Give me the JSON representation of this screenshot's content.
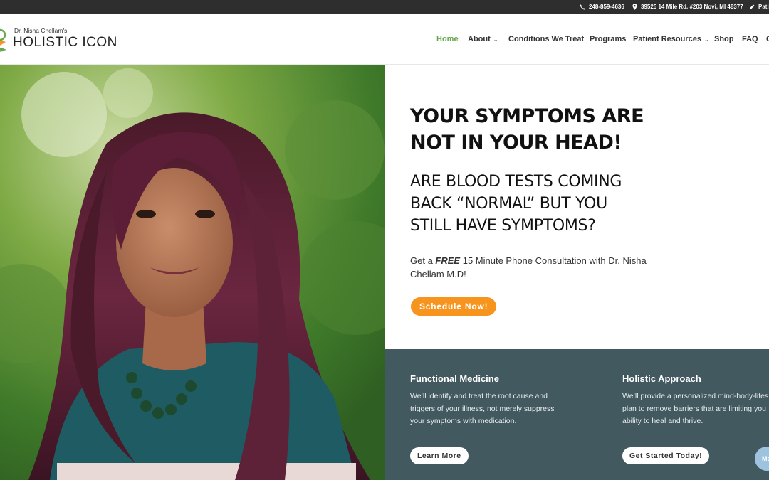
{
  "colors": {
    "topbar_bg": "#2e2e2e",
    "nav_active": "#6aa84f",
    "cta_orange": "#f7941d",
    "panel_bg": "#435960"
  },
  "topbar": {
    "phone": "248-859-4636",
    "phone_icon": "phone-icon",
    "address": "39525 14 Mile Rd. #203 Novi, MI 48377",
    "address_icon": "map-pin-icon",
    "portal": "Pati",
    "portal_icon": "pen-icon"
  },
  "logo": {
    "pre": "Dr. Nisha Chellam's",
    "main": "HOLISTIC ICON"
  },
  "nav": [
    {
      "label": "Home",
      "dropdown": false,
      "active": true
    },
    {
      "label": "About",
      "dropdown": true,
      "active": false
    },
    {
      "label": "Conditions We Treat",
      "dropdown": false,
      "active": false
    },
    {
      "label": "Programs",
      "dropdown": false,
      "active": false
    },
    {
      "label": "Patient Resources",
      "dropdown": true,
      "active": false
    },
    {
      "label": "Shop",
      "dropdown": false,
      "active": false
    },
    {
      "label": "FAQ",
      "dropdown": false,
      "active": false
    },
    {
      "label": "C",
      "dropdown": false,
      "active": false
    }
  ],
  "hero": {
    "title_line1": "YOUR SYMPTOMS ARE",
    "title_line2": "NOT IN YOUR HEAD!",
    "sub_line1": "ARE BLOOD TESTS COMING",
    "sub_line2": "BACK “NORMAL” BUT YOU",
    "sub_line3": "STILL HAVE SYMPTOMS?",
    "cta_prefix": "Get a",
    "cta_free": "FREE",
    "cta_suffix": "15 Minute Phone Consultation with Dr. Nisha Chellam M.D!",
    "cta_button": "Schedule Now!"
  },
  "panels": [
    {
      "title": "Functional Medicine",
      "line1": "We’ll identify and treat the root cause and",
      "line2": "triggers of your illness, not merely suppress",
      "line3": "your symptoms with medication.",
      "button": "Learn More"
    },
    {
      "title": "Holistic Approach",
      "line1": "We’ll provide a personalized mind-body-lifes",
      "line2": "plan to remove barriers that are limiting you",
      "line3": "ability to heal and thrive.",
      "button": "Get Started Today!"
    }
  ],
  "chat": {
    "label": "Me"
  }
}
